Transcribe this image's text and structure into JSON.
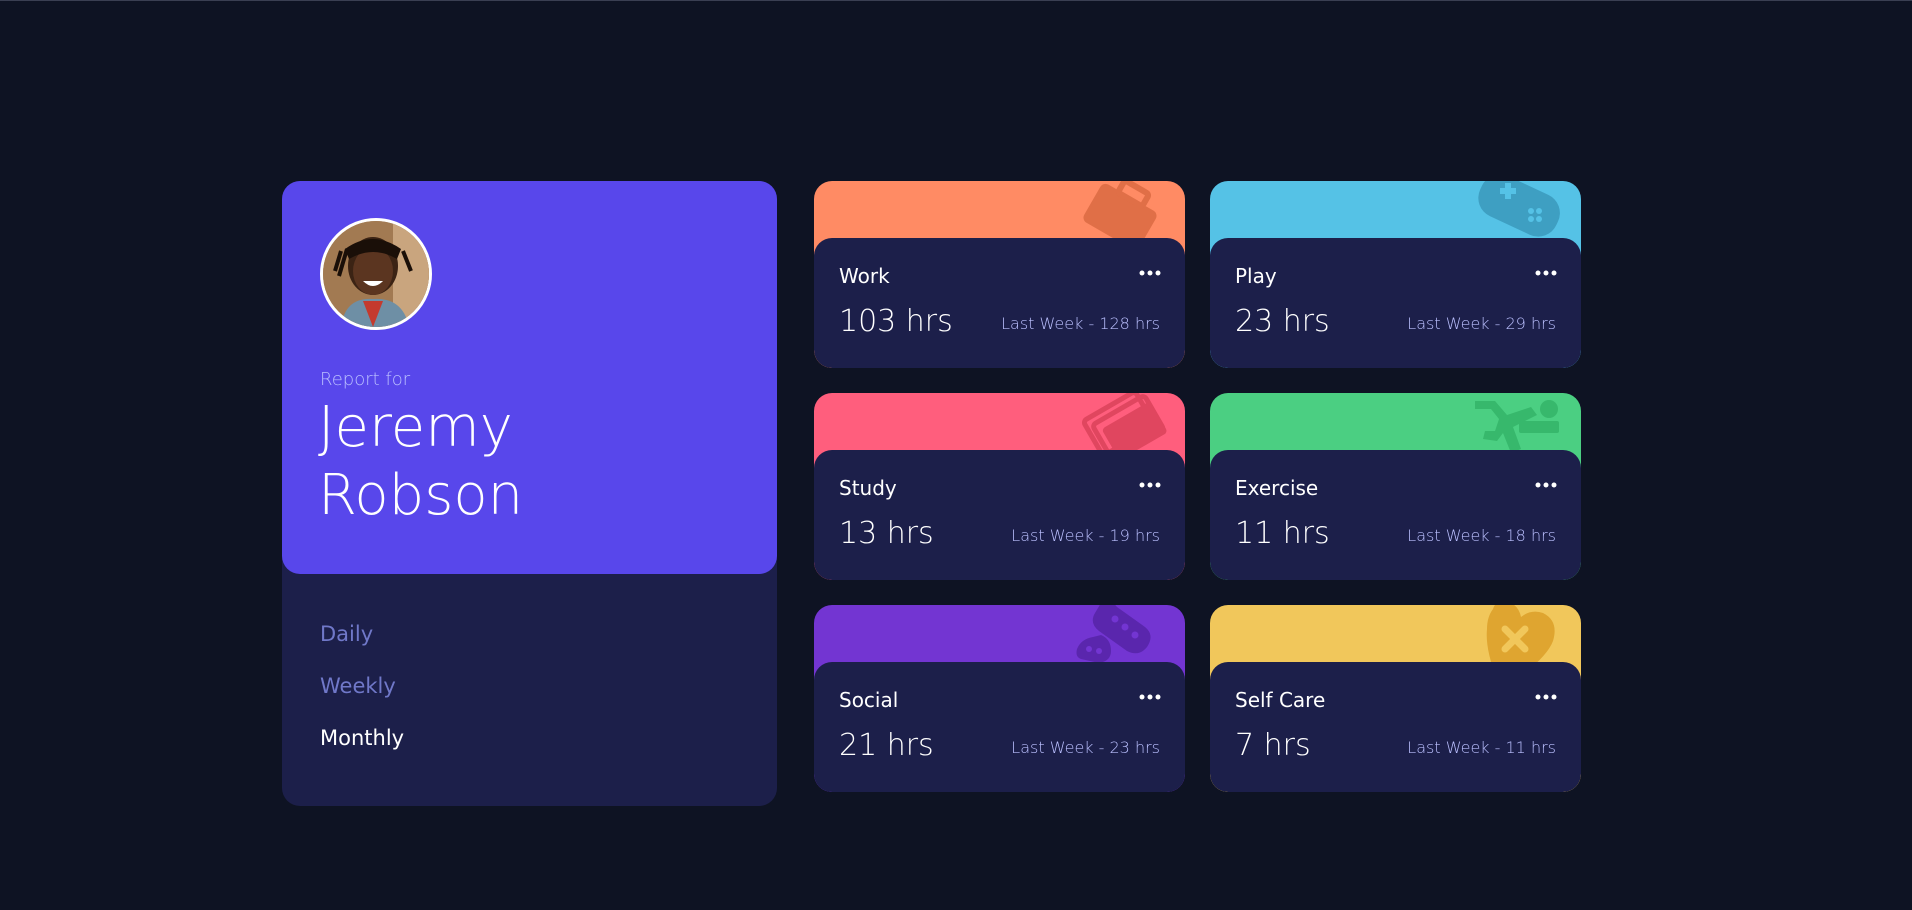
{
  "profile": {
    "report_for": "Report for",
    "name": "Jeremy Robson"
  },
  "periods": [
    {
      "label": "Daily",
      "active": false
    },
    {
      "label": "Weekly",
      "active": false
    },
    {
      "label": "Monthly",
      "active": true
    }
  ],
  "colors": {
    "background": "#0e1323",
    "profile": "#5847eb",
    "card": "#1c1f4a",
    "muted_text": "#bbc0ff",
    "inactive_period": "#7078c9"
  },
  "activities": [
    {
      "title": "Work",
      "current": "103 hrs",
      "previous": "Last Week - 128 hrs",
      "color": "#ff8b64",
      "icon": "briefcase-icon"
    },
    {
      "title": "Play",
      "current": "23 hrs",
      "previous": "Last Week - 29 hrs",
      "color": "#55c2e6",
      "icon": "gamepad-icon"
    },
    {
      "title": "Study",
      "current": "13 hrs",
      "previous": "Last Week - 19 hrs",
      "color": "#ff5e7d",
      "icon": "books-icon"
    },
    {
      "title": "Exercise",
      "current": "11 hrs",
      "previous": "Last Week - 18 hrs",
      "color": "#4bcf82",
      "icon": "running-icon"
    },
    {
      "title": "Social",
      "current": "21 hrs",
      "previous": "Last Week - 23 hrs",
      "color": "#7335d2",
      "icon": "speech-bubble-icon"
    },
    {
      "title": "Self Care",
      "current": "7 hrs",
      "previous": "Last Week - 11 hrs",
      "color": "#f1c75b",
      "icon": "heart-bandage-icon"
    }
  ]
}
